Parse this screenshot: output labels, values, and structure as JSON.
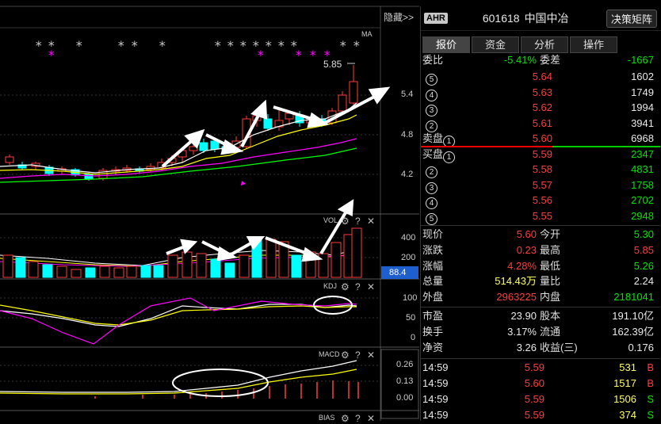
{
  "chart": {
    "hide_label": "隐藏>>",
    "ma_label": "MA",
    "price_marker": "5.85",
    "price_axis": [
      "5.4",
      "4.8",
      "4.2"
    ],
    "vol_label": "VOL",
    "vol_axis": [
      "400",
      "200"
    ],
    "vol_value_box": "88.4",
    "kdj_label": "KDJ",
    "kdj_axis": [
      "100",
      "50",
      "0"
    ],
    "macd_label": "MACD",
    "macd_axis": [
      "0.26",
      "0.13",
      "0.00"
    ],
    "bias_label": "BIAS",
    "help_glyph": "?",
    "close_glyph": "✕",
    "star_glyph": "*",
    "gear_glyph": "⚙",
    "colors": {
      "up": "#ff3c3c",
      "down": "#00ffff",
      "ma5": "#ffffff",
      "ma10": "#ffff00",
      "ma20": "#ff00ff",
      "ma60": "#00ff00",
      "star_white": "#c8c8c8",
      "star_magenta": "#ff00ff"
    }
  },
  "quote": {
    "badge": "AHR",
    "code": "601618",
    "name": "中国中冶",
    "strategy_button": "决策矩阵",
    "tabs": [
      "报价",
      "资金",
      "分析",
      "操作"
    ],
    "weibi_label": "委比",
    "weibi_value": "-5.41%",
    "weicha_label": "委差",
    "weicha_value": "-1667",
    "sell": [
      {
        "label": "⑤",
        "price": "5.64",
        "vol": "1602"
      },
      {
        "label": "④",
        "price": "5.63",
        "vol": "1749"
      },
      {
        "label": "③",
        "price": "5.62",
        "vol": "1994"
      },
      {
        "label": "②",
        "price": "5.61",
        "vol": "3941"
      },
      {
        "label": "卖盘①",
        "price": "5.60",
        "vol": "6968"
      }
    ],
    "buy": [
      {
        "label": "买盘①",
        "price": "5.59",
        "vol": "2347"
      },
      {
        "label": "②",
        "price": "5.58",
        "vol": "4831"
      },
      {
        "label": "③",
        "price": "5.57",
        "vol": "1758"
      },
      {
        "label": "④",
        "price": "5.56",
        "vol": "2702"
      },
      {
        "label": "⑤",
        "price": "5.55",
        "vol": "2948"
      }
    ],
    "stats": [
      {
        "l1": "现价",
        "v1": "5.60",
        "c1": "red",
        "l2": "今开",
        "v2": "5.30",
        "c2": "green"
      },
      {
        "l1": "涨跌",
        "v1": "0.23",
        "c1": "red",
        "l2": "最高",
        "v2": "5.85",
        "c2": "red"
      },
      {
        "l1": "涨幅",
        "v1": "4.28%",
        "c1": "red",
        "l2": "最低",
        "v2": "5.26",
        "c2": "green"
      },
      {
        "l1": "总量",
        "v1": "514.43万",
        "c1": "yel",
        "l2": "量比",
        "v2": "2.24",
        "c2": "wht"
      },
      {
        "l1": "外盘",
        "v1": "2963225",
        "c1": "red",
        "l2": "内盘",
        "v2": "2181041",
        "c2": "green"
      }
    ],
    "fundamentals": [
      {
        "l1": "市盈",
        "v1": "23.90",
        "l2": "股本",
        "v2": "191.10亿"
      },
      {
        "l1": "换手",
        "v1": "3.17%",
        "l2": "流通",
        "v2": "162.39亿"
      },
      {
        "l1": "净资",
        "v1": "3.26",
        "l2": "收益(三)",
        "v2": "0.176"
      }
    ],
    "ticks": [
      {
        "time": "14:59",
        "price": "5.59",
        "vol": "531",
        "side": "B"
      },
      {
        "time": "14:59",
        "price": "5.60",
        "vol": "1517",
        "side": "B"
      },
      {
        "time": "14:59",
        "price": "5.59",
        "vol": "1506",
        "side": "S"
      },
      {
        "time": "14:59",
        "price": "5.59",
        "vol": "374",
        "side": "S"
      }
    ]
  }
}
